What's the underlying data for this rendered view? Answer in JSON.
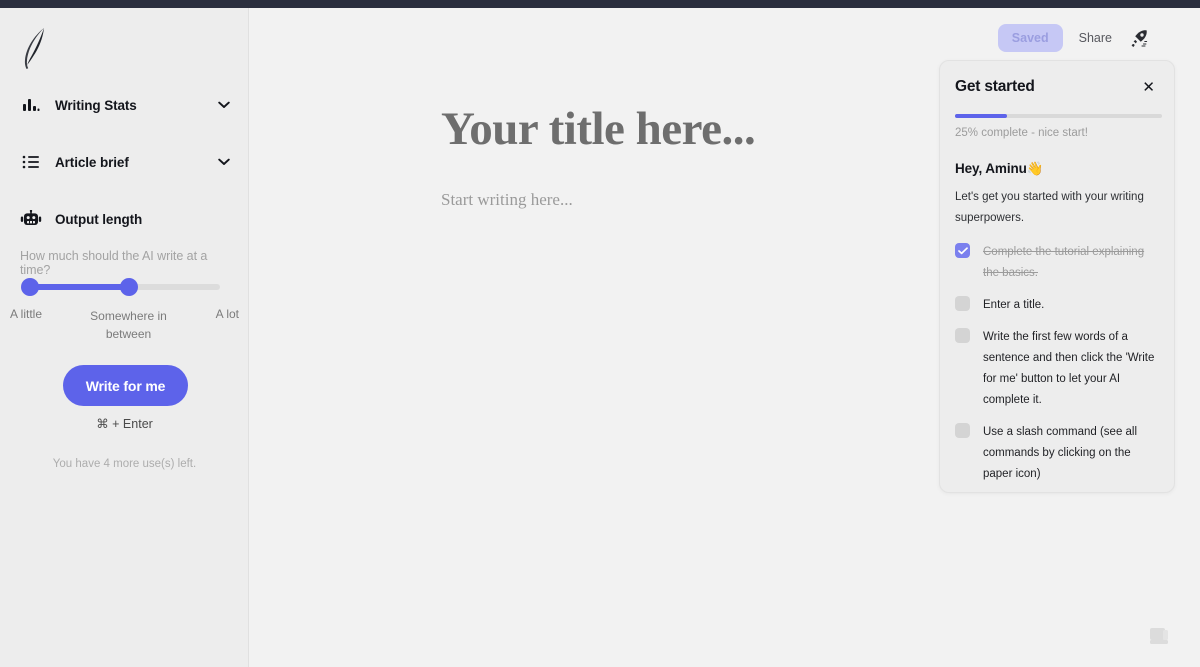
{
  "app": {
    "logo_icon": "feather-quill-icon",
    "accent_color": "#5d63ea",
    "top_strip_color": "#2b2f3e",
    "sidebar_bg": "#ededed",
    "canvas_bg": "#f2f2f2"
  },
  "sidebar": {
    "items": [
      {
        "label": "Writing Stats",
        "icon": "bar-chart-icon",
        "chevron": "chevron-down-icon"
      },
      {
        "label": "Article brief",
        "icon": "list-icon",
        "chevron": "chevron-down-icon"
      },
      {
        "label": "Output length",
        "icon": "robot-icon"
      }
    ],
    "output_length": {
      "helper": "How much should the AI write at a time?",
      "slider": {
        "min_label": "A little",
        "mid_label": "Somewhere in between",
        "max_label": "A lot",
        "value_percent": 54
      },
      "write_button": "Write for me",
      "shortcut": "⌘ + Enter",
      "uses_left": "You have 4 more use(s) left."
    }
  },
  "toolbar": {
    "saved_label": "Saved",
    "share_label": "Share",
    "rocket_icon": "rocket-icon"
  },
  "editor": {
    "title_placeholder": "Your title here...",
    "body_placeholder": "Start writing here...",
    "paper_icon": "paper-commands-icon"
  },
  "panel": {
    "title": "Get started",
    "close_icon": "close-icon",
    "progress_percent": 25,
    "progress_caption": "25% complete - nice start!",
    "greeting": "Hey, Aminu",
    "greeting_emoji": "👋",
    "intro": "Let's get you started with your writing superpowers.",
    "checklist": [
      {
        "text": "Complete the tutorial explaining the basics.",
        "checked": true
      },
      {
        "text": "Enter a title.",
        "checked": false
      },
      {
        "text": "Write the first few words of a sentence and then click the 'Write for me' button to let your AI complete it.",
        "checked": false
      },
      {
        "text": "Use a slash command (see all commands by clicking on the paper icon)",
        "checked": false
      }
    ]
  }
}
